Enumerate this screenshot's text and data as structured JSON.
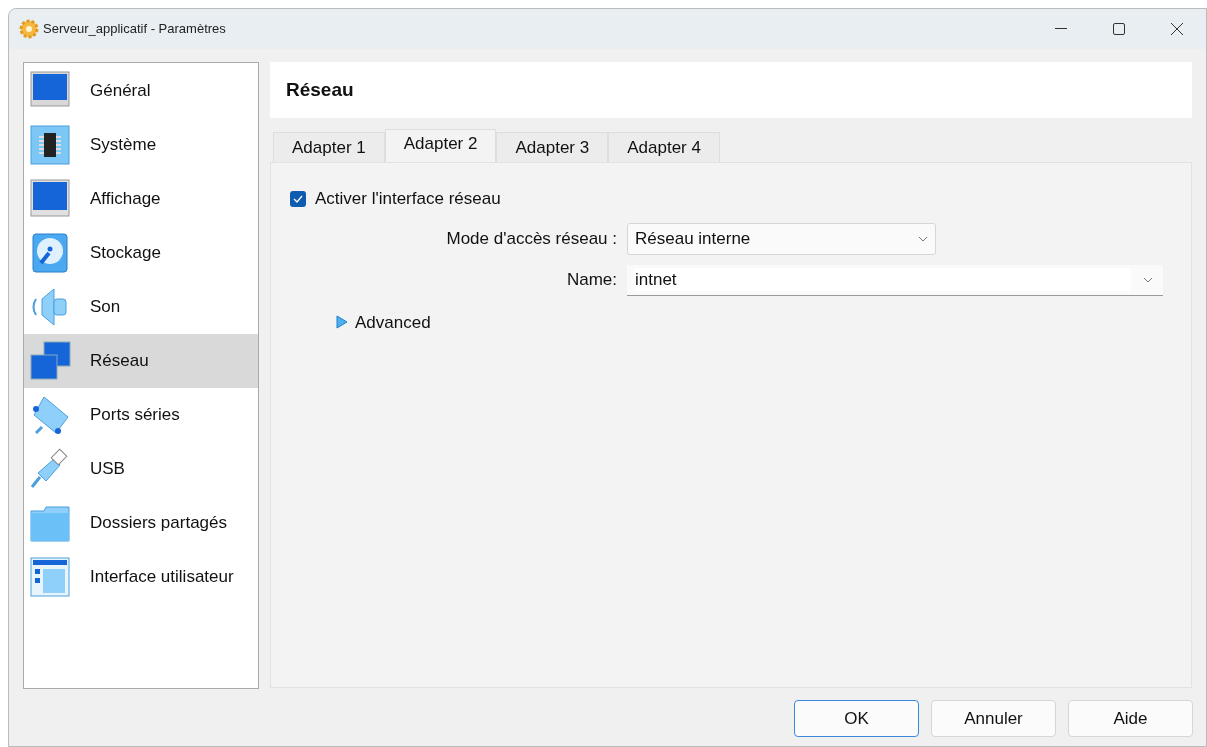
{
  "window": {
    "title": "Serveur_applicatif - Paramètres"
  },
  "sidebar": {
    "items": [
      {
        "label": "Général",
        "selected": false
      },
      {
        "label": "Système",
        "selected": false
      },
      {
        "label": "Affichage",
        "selected": false
      },
      {
        "label": "Stockage",
        "selected": false
      },
      {
        "label": "Son",
        "selected": false
      },
      {
        "label": "Réseau",
        "selected": true
      },
      {
        "label": "Ports séries",
        "selected": false
      },
      {
        "label": "USB",
        "selected": false
      },
      {
        "label": "Dossiers partagés",
        "selected": false
      },
      {
        "label": "Interface utilisateur",
        "selected": false
      }
    ]
  },
  "page": {
    "title": "Réseau"
  },
  "tabs": [
    {
      "label": "Adapter 1",
      "selected": false
    },
    {
      "label": "Adapter 2",
      "selected": true
    },
    {
      "label": "Adapter 3",
      "selected": false
    },
    {
      "label": "Adapter 4",
      "selected": false
    }
  ],
  "enable": {
    "label": "Activer l'interface réseau",
    "checked": true
  },
  "attached": {
    "label": "Mode d'accès réseau :",
    "value": "Réseau interne"
  },
  "name": {
    "label": "Name:",
    "value": "intnet"
  },
  "advanced": {
    "label": "Advanced",
    "expanded": false
  },
  "buttons": [
    {
      "label": "OK",
      "default": true
    },
    {
      "label": "Annuler",
      "default": false
    },
    {
      "label": "Aide",
      "default": false
    }
  ]
}
